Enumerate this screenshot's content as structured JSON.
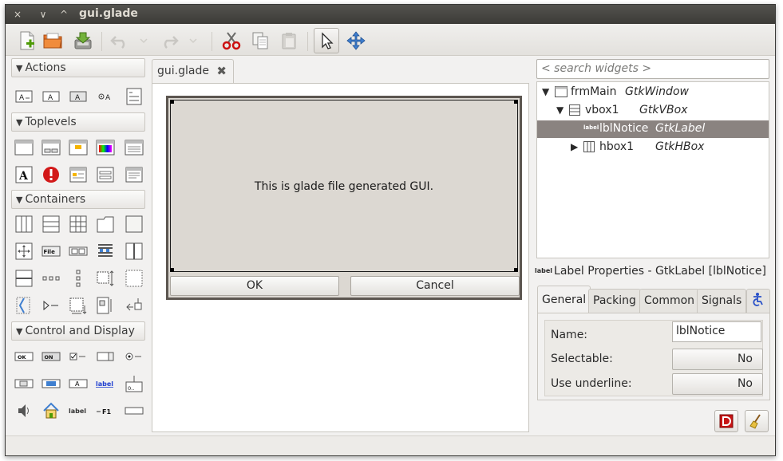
{
  "window": {
    "title": "gui.glade",
    "controls": [
      "×",
      "∨",
      "^"
    ]
  },
  "toolbar": {
    "tools": [
      "new-file-icon",
      "open-folder-icon",
      "save-icon",
      "undo-icon",
      "redo-icon",
      "cut-icon",
      "copy-icon",
      "paste-icon",
      "select-pointer-icon",
      "drag-resize-icon"
    ]
  },
  "palette": {
    "groups": [
      {
        "label": "Actions"
      },
      {
        "label": "Toplevels"
      },
      {
        "label": "Containers"
      },
      {
        "label": "Control and Display"
      }
    ],
    "widget_texts": {
      "file": "File",
      "label_link": "label",
      "label_plain": "label",
      "f1": "F1",
      "dots": "0..",
      "ok": "OK",
      "on": "ON"
    }
  },
  "editor": {
    "tab_label": "gui.glade",
    "tab_close": "✖",
    "notice_text": "This is glade file generated GUI.",
    "ok_button": "OK",
    "cancel_button": "Cancel"
  },
  "inspector": {
    "search_placeholder": "< search widgets >",
    "rows": [
      {
        "name": "frmMain",
        "cls": "GtkWindow",
        "expander": "▼"
      },
      {
        "name": "vbox1",
        "cls": "GtkVBox",
        "expander": "▼"
      },
      {
        "name": "lblNotice",
        "cls": "GtkLabel",
        "icon_text": "label"
      },
      {
        "name": "hbox1",
        "cls": "GtkHBox",
        "expander": "▶"
      }
    ]
  },
  "properties": {
    "icon_text": "label",
    "title": "Label Properties - GtkLabel [lblNotice]",
    "tabs": [
      "General",
      "Packing",
      "Common",
      "Signals"
    ],
    "fields": {
      "name_label": "Name:",
      "name_value": "lblNotice",
      "selectable_label": "Selectable:",
      "selectable_value": "No",
      "underline_label": "Use underline:",
      "underline_value": "No"
    }
  }
}
